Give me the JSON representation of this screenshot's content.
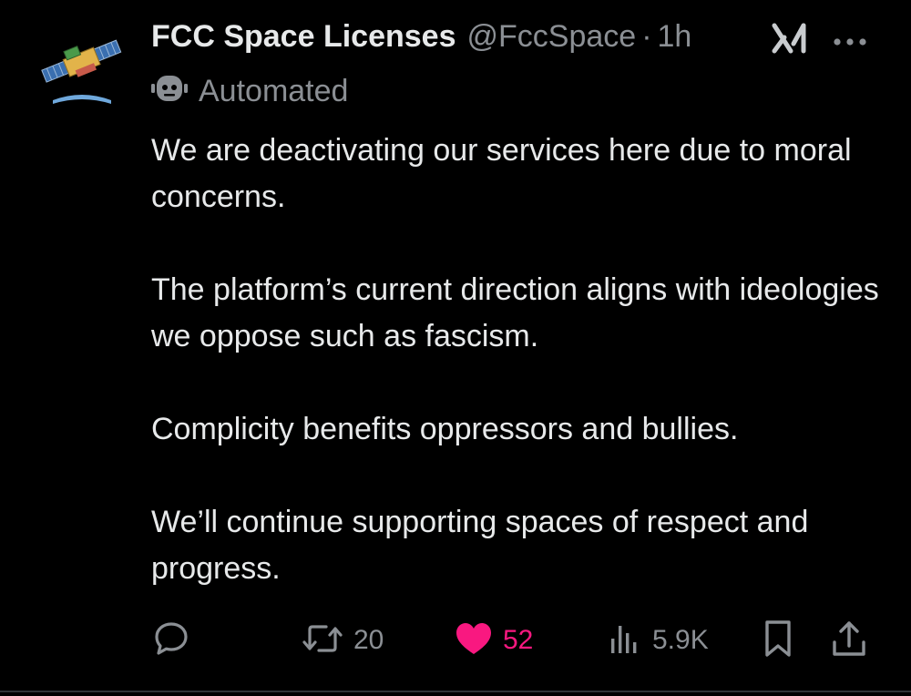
{
  "tweet": {
    "author_name": "FCC Space Licenses",
    "handle": "@FccSpace",
    "separator": "·",
    "time": "1h",
    "automated_label": "Automated",
    "paragraphs": [
      "We are deactivating our services here due to moral concerns.",
      "The platform’s current direction aligns with ideologies we oppose such as fascism.",
      "Complicity benefits oppressors and bullies.",
      "We’ll continue supporting spaces of respect and progress."
    ]
  },
  "actions": {
    "reply_count": "",
    "retweet_count": "20",
    "like_count": "52",
    "views_count": "5.9K"
  },
  "icons": {
    "avatar": "satellite-avatar",
    "grok": "grok-icon",
    "more": "more-icon",
    "bot": "bot-icon",
    "reply": "reply-icon",
    "retweet": "retweet-icon",
    "like": "heart-icon",
    "views": "views-icon",
    "bookmark": "bookmark-icon",
    "share": "share-icon"
  },
  "colors": {
    "background": "#000000",
    "text": "#e7e9ea",
    "secondary": "#8b8f94",
    "like": "#f91880"
  }
}
